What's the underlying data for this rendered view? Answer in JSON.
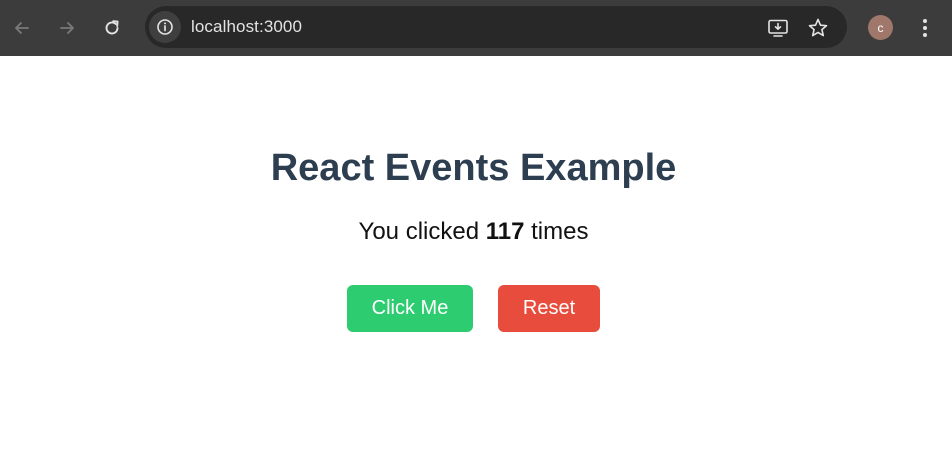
{
  "browser": {
    "url": "localhost:3000",
    "profile_initial": "c",
    "icons": {
      "back": "arrow-left-icon",
      "forward": "arrow-right-icon",
      "reload": "reload-icon",
      "site_info": "info-icon",
      "install": "install-app-icon",
      "bookmark": "star-icon",
      "menu": "kebab-menu-icon"
    }
  },
  "app": {
    "title": "React Events Example",
    "counter": {
      "prefix": "You clicked",
      "count": "117",
      "suffix": "times"
    },
    "buttons": {
      "click_label": "Click Me",
      "reset_label": "Reset"
    }
  },
  "colors": {
    "title": "#2c3e50",
    "click_button": "#2ecc71",
    "reset_button": "#e74c3c",
    "browser_bar": "#3c3c3c"
  }
}
